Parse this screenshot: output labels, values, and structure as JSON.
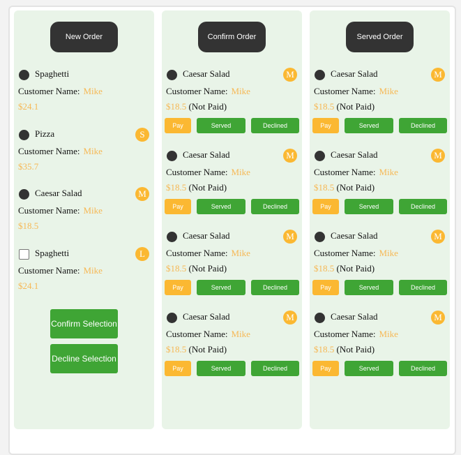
{
  "columns": [
    {
      "title": "New Order",
      "items": [
        {
          "name": "Spaghetti",
          "size": "",
          "customer_label": "Customer Name:",
          "customer": "Mike",
          "price": "$24.1",
          "selected": true
        },
        {
          "name": "Pizza",
          "size": "S",
          "customer_label": "Customer Name:",
          "customer": "Mike",
          "price": "$35.7",
          "selected": true
        },
        {
          "name": "Caesar Salad",
          "size": "M",
          "customer_label": "Customer Name:",
          "customer": "Mike",
          "price": "$18.5",
          "selected": true
        },
        {
          "name": "Spaghetti",
          "size": "L",
          "customer_label": "Customer Name:",
          "customer": "Mike",
          "price": "$24.1",
          "selected": false
        }
      ],
      "confirm_label": "Confirm Selection",
      "decline_label": "Decline Selection"
    },
    {
      "title": "Confirm Order",
      "items": [
        {
          "name": "Caesar Salad",
          "size": "M",
          "customer_label": "Customer Name:",
          "customer": "Mike",
          "price": "$18.5",
          "status": "(Not Paid)"
        },
        {
          "name": "Caesar Salad",
          "size": "M",
          "customer_label": "Customer Name:",
          "customer": "Mike",
          "price": "$18.5",
          "status": "(Not Paid)"
        },
        {
          "name": "Caesar Salad",
          "size": "M",
          "customer_label": "Customer Name:",
          "customer": "Mike",
          "price": "$18.5",
          "status": "(Not Paid)"
        },
        {
          "name": "Caesar Salad",
          "size": "M",
          "customer_label": "Customer Name:",
          "customer": "Mike",
          "price": "$18.5",
          "status": "(Not Paid)"
        }
      ]
    },
    {
      "title": "Served Order",
      "items": [
        {
          "name": "Caesar Salad",
          "size": "M",
          "customer_label": "Customer Name:",
          "customer": "Mike",
          "price": "$18.5",
          "status": "(Not Paid)"
        },
        {
          "name": "Caesar Salad",
          "size": "M",
          "customer_label": "Customer Name:",
          "customer": "Mike",
          "price": "$18.5",
          "status": "(Not Paid)"
        },
        {
          "name": "Caesar Salad",
          "size": "M",
          "customer_label": "Customer Name:",
          "customer": "Mike",
          "price": "$18.5",
          "status": "(Not Paid)"
        },
        {
          "name": "Caesar Salad",
          "size": "M",
          "customer_label": "Customer Name:",
          "customer": "Mike",
          "price": "$18.5",
          "status": "(Not Paid)"
        }
      ]
    }
  ],
  "buttons": {
    "pay": "Pay",
    "served": "Served",
    "declined": "Declined"
  },
  "colors": {
    "accent": "#fbb832",
    "green": "#3fa535",
    "dark": "#333333",
    "panel": "#e9f4e8"
  }
}
